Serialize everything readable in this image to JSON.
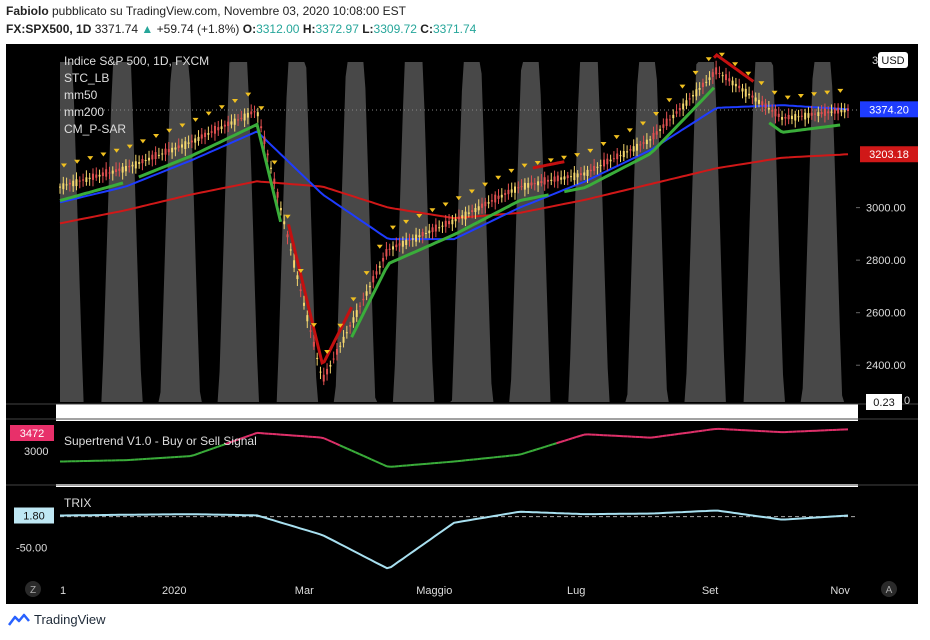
{
  "header": {
    "line1": {
      "user": "Fabiolo",
      "text": " pubblicato su TradingView.com, Novembre 03, 2020 10:08:00 EST"
    },
    "line2": {
      "symbol": "FX:SPX500, 1D",
      "price": " 3371.74 ",
      "arrow": "▲",
      "change": "+59.74 (+1.8%)",
      "o_label": "O:",
      "o": "3312.00",
      "h_label": "H:",
      "h": "3372.97",
      "l_label": "L:",
      "l": "3309.72",
      "c_label": "C:",
      "c": "3371.74"
    }
  },
  "legend": {
    "title": "Indice S&P 500, 1D, FXCM",
    "items": [
      "STC_LB",
      "mm50",
      "mm200",
      "CM_P-SAR"
    ]
  },
  "price_scale": {
    "currency": "USD",
    "top_label": "3",
    "ticks": [
      "3000.00",
      "2800.00",
      "2600.00",
      "2400.00"
    ],
    "blue_label": "3374.20",
    "red_label": "3203.18",
    "stc_label": "0.23",
    "stc_tail": "0"
  },
  "supertrend_pane": {
    "title": "Supertrend V1.0 - Buy or Sell Signal",
    "left_label": "3472",
    "tick": "3000"
  },
  "trix_pane": {
    "title": "TRIX",
    "left_label": "1.80",
    "tick": "-50.00"
  },
  "time_axis": {
    "labels": [
      "1",
      "2020",
      "Mar",
      "Maggio",
      "Lug",
      "Set",
      "Nov"
    ],
    "left_badge": "Z",
    "right_badge": "A"
  },
  "footer": {
    "brand": "TradingView"
  },
  "colors": {
    "bg": "#000000",
    "up": "#26a69a",
    "candle_up": "#f5d76e",
    "candle_down": "#e05050",
    "ma50": "#1e3cff",
    "ma200": "#d01818",
    "stc": "#555555",
    "sar_up": "#3aad3a",
    "sar_down": "#c41010",
    "trix": "#a8e0f0",
    "arrow": "#f0c020"
  },
  "chart_data": {
    "type": "line",
    "timeline": [
      "2019-11",
      "2019-12",
      "2020-01",
      "2020-02",
      "2020-03",
      "2020-04",
      "2020-05",
      "2020-06",
      "2020-07",
      "2020-08",
      "2020-09",
      "2020-10",
      "2020-11"
    ],
    "price": [
      3080,
      3150,
      3250,
      3370,
      2340,
      2840,
      2950,
      3080,
      3130,
      3260,
      3520,
      3340,
      3371.74
    ],
    "ma50": [
      3020,
      3080,
      3180,
      3290,
      3050,
      2880,
      2880,
      3000,
      3100,
      3220,
      3380,
      3390,
      3374.2
    ],
    "ma200": [
      2940,
      2990,
      3050,
      3100,
      3080,
      3000,
      2960,
      2980,
      3030,
      3090,
      3150,
      3190,
      3203.18
    ],
    "ylim": [
      2260,
      3600
    ],
    "supertrend": {
      "range": [
        2700,
        3550
      ],
      "values": [
        3000,
        3020,
        3080,
        3420,
        3350,
        2920,
        3000,
        3100,
        3400,
        3350,
        3480,
        3430,
        3472
      ]
    },
    "trix": {
      "range": [
        -90,
        40
      ],
      "values": [
        1.8,
        3,
        4,
        2,
        -30,
        -85,
        -10,
        8,
        4,
        5,
        10,
        -5,
        1.8
      ]
    }
  }
}
